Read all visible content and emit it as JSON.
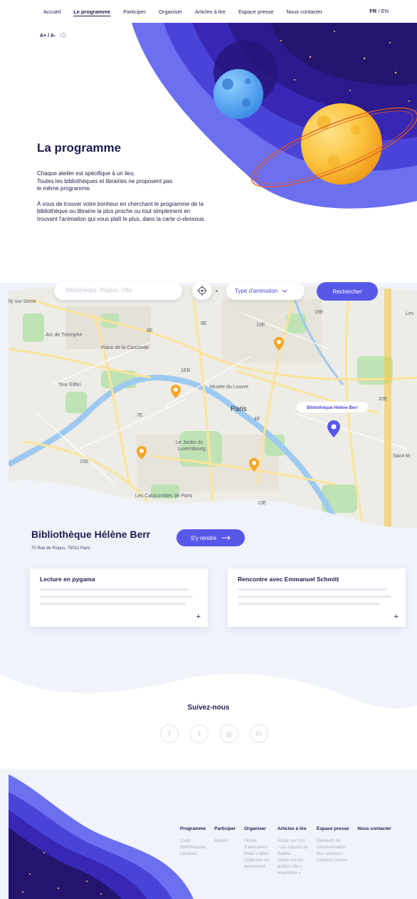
{
  "nav": {
    "items": [
      "Accueil",
      "Le programme",
      "Participer",
      "Organiser",
      "Articles à lire",
      "Espace presse",
      "Nous contacter"
    ],
    "active_index": 1,
    "lang_active": "FR",
    "lang_sep": " / ",
    "lang_other": "EN"
  },
  "a11y": {
    "font_size": "A+ / A-",
    "audio_icon": "speaker-icon"
  },
  "hero": {
    "title": "La programme",
    "para1_l1": "Chaque atelier est spécifique à un lieu.",
    "para1_l2": "Toutes les bibliothèques et librairies ne proposent pas",
    "para1_l3": "le même programme.",
    "para2_l1": "À vous de trouver votre bonheur en cherchant le programme de la",
    "para2_l2": "bibliothèque ou librairie la plus proche ou tout simplement en",
    "para2_l3": "trouvant l'animation qui vous plaît le plus, dans la carte ci-dessous."
  },
  "search": {
    "placeholder": "Bibliothèque, Région, Ville",
    "type_label": "Type d'animation",
    "button": "Rechercher"
  },
  "map": {
    "labels": [
      "lly sur-Seine",
      "Arc de Triomphe",
      "8E",
      "9E",
      "10E",
      "19E",
      "Les",
      "Place de la Concorde",
      "1ER",
      "Musée du Louvre",
      "Tour Eiffel",
      "7E",
      "Paris",
      "4E",
      "20E",
      "15E",
      "Le Jardin du",
      "Luxembourg",
      "Les Catacombes de Paris",
      "13E",
      "Saint-M"
    ],
    "selected_label": "Bibliothèque Hélène Berr"
  },
  "library": {
    "name": "Bibliothèque Hélène Berr",
    "address": "70 Rue de Picpus, 75012 Paris",
    "go_label": "S'y rendre"
  },
  "cards": [
    {
      "title": "Lecture en pygama"
    },
    {
      "title": "Rencontre avec Emmanuel Schmitt"
    }
  ],
  "social": {
    "title": "Suivez-nous",
    "icons": [
      "facebook-icon",
      "twitter-icon",
      "instagram-icon",
      "linkedin-icon"
    ],
    "glyphs": [
      "f",
      "t",
      "◎",
      "in"
    ]
  },
  "footer": {
    "cols": [
      {
        "title": "Programme",
        "links": [
          "Carte",
          "Bibliothèques",
          "Librairies"
        ]
      },
      {
        "title": "Participer",
        "links": [
          "Ateliers"
        ]
      },
      {
        "title": "Organiser",
        "links": [
          "Fiches",
          "d'animations",
          "Boite à idées",
          "Organiser un",
          "évènement"
        ]
      },
      {
        "title": "Articles à lire",
        "links": [
          "Article sur l'AC",
          "/ Les classes de",
          "théâtre",
          "Article sur les",
          "publics dits «",
          "empêchés »"
        ]
      },
      {
        "title": "Espace presse",
        "links": [
          "Éléments de",
          "communication",
          "Nos sponsors",
          "Contacts presse"
        ]
      },
      {
        "title": "Nous contacter",
        "links": []
      }
    ]
  },
  "colors": {
    "primary": "#5858e8",
    "navy": "#1d1d4f",
    "orange": "#f5a623",
    "space": "#2a1a6e"
  }
}
